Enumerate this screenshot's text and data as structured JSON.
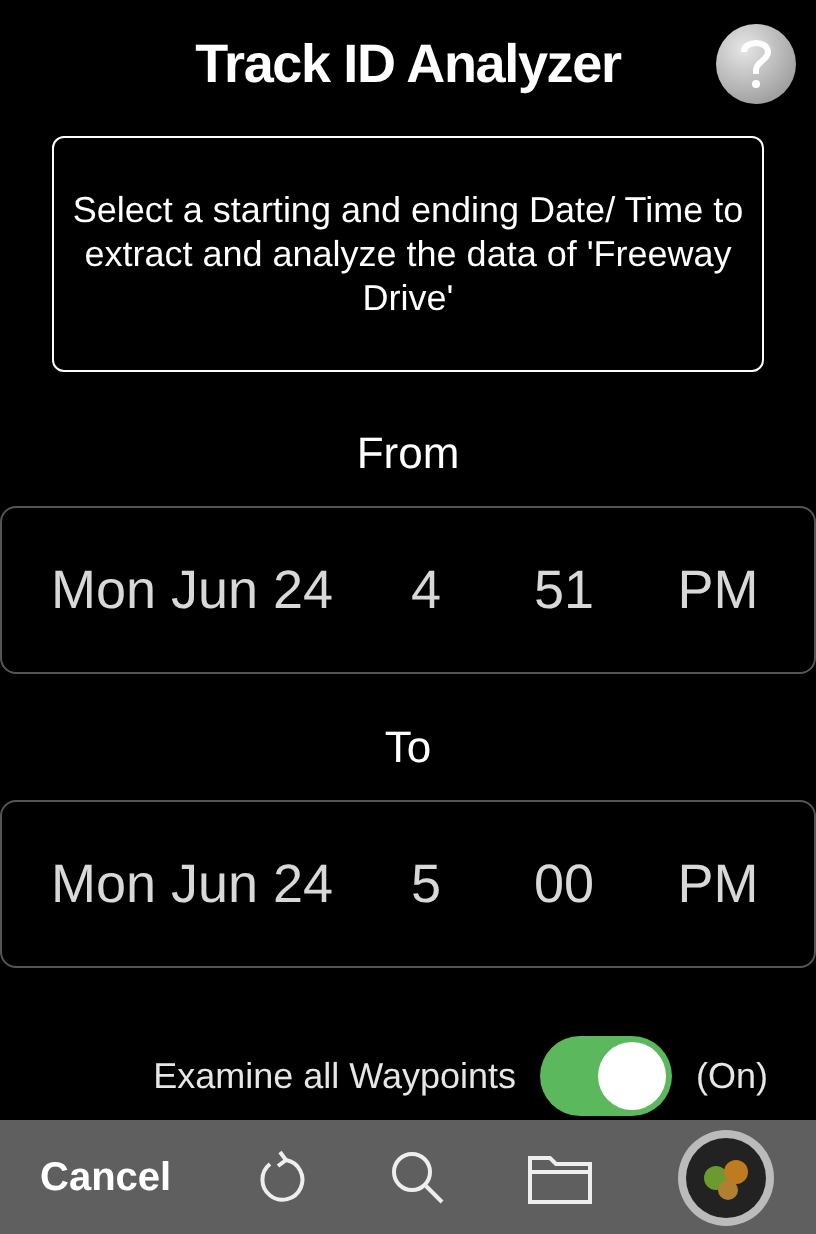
{
  "title": "Track ID Analyzer",
  "instructions": "Select a starting and ending Date/ Time to extract and analyze the data of 'Freeway Drive'",
  "pickers": [
    {
      "label": "From",
      "date": "Mon Jun 24",
      "hour": "4",
      "minute": "51",
      "ampm": "PM"
    },
    {
      "label": "To",
      "date": "Mon Jun 24",
      "hour": "5",
      "minute": "00",
      "ampm": "PM"
    }
  ],
  "waypoints": {
    "label": "Examine all Waypoints",
    "on": true,
    "state_text": "(On)"
  },
  "toolbar": {
    "cancel": "Cancel"
  }
}
